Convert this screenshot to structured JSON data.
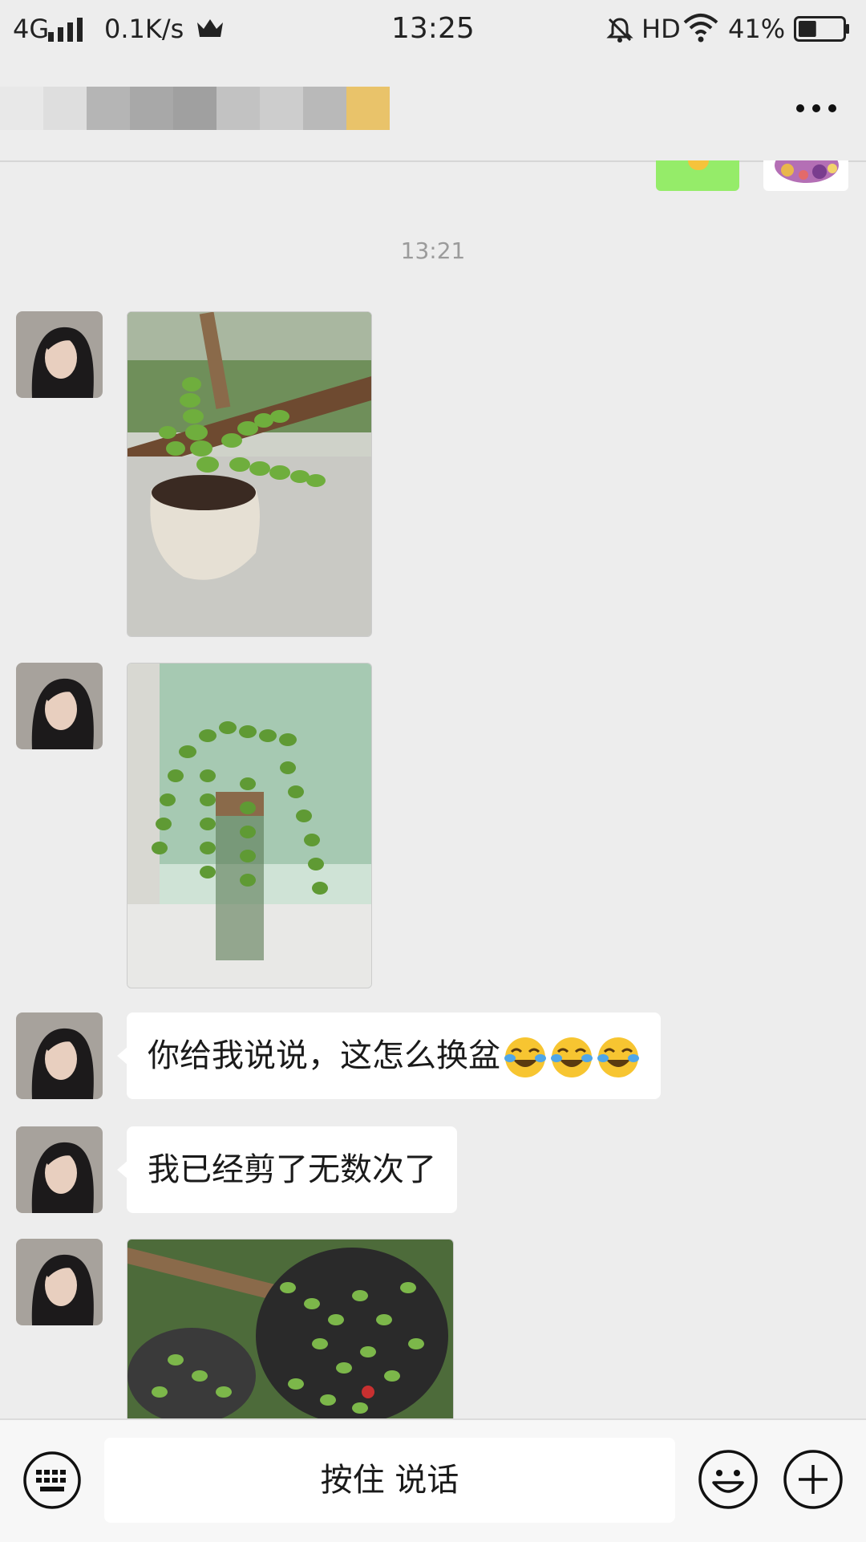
{
  "status_bar": {
    "network": "4G",
    "speed": "0.1K/s",
    "time": "13:25",
    "hd": "HD",
    "battery_percent": "41%",
    "battery_level": 0.41
  },
  "header": {
    "more_icon": "more-dots-icon"
  },
  "chat": {
    "timestamp": "13:21",
    "messages": [
      {
        "type": "image",
        "content": "succulent-in-white-pot-photo"
      },
      {
        "type": "image",
        "content": "hanging-succulent-in-glass-vase-photo"
      },
      {
        "type": "text",
        "text": "你给我说说，这怎么换盆",
        "emoji": [
          "crying-laughing-emoji",
          "crying-laughing-emoji",
          "crying-laughing-emoji"
        ]
      },
      {
        "type": "text",
        "text": "我已经剪了无数次了"
      },
      {
        "type": "image",
        "content": "succulents-in-dark-pots-photo"
      }
    ]
  },
  "input_bar": {
    "voice_label": "按住 说话",
    "keyboard_icon": "keyboard-icon",
    "emoji_icon": "smiley-icon",
    "plus_icon": "plus-icon"
  },
  "colors": {
    "background": "#ededed",
    "sent_bubble": "#95ec69",
    "received_bubble": "#ffffff",
    "title_highlight": "#e9c36a"
  }
}
